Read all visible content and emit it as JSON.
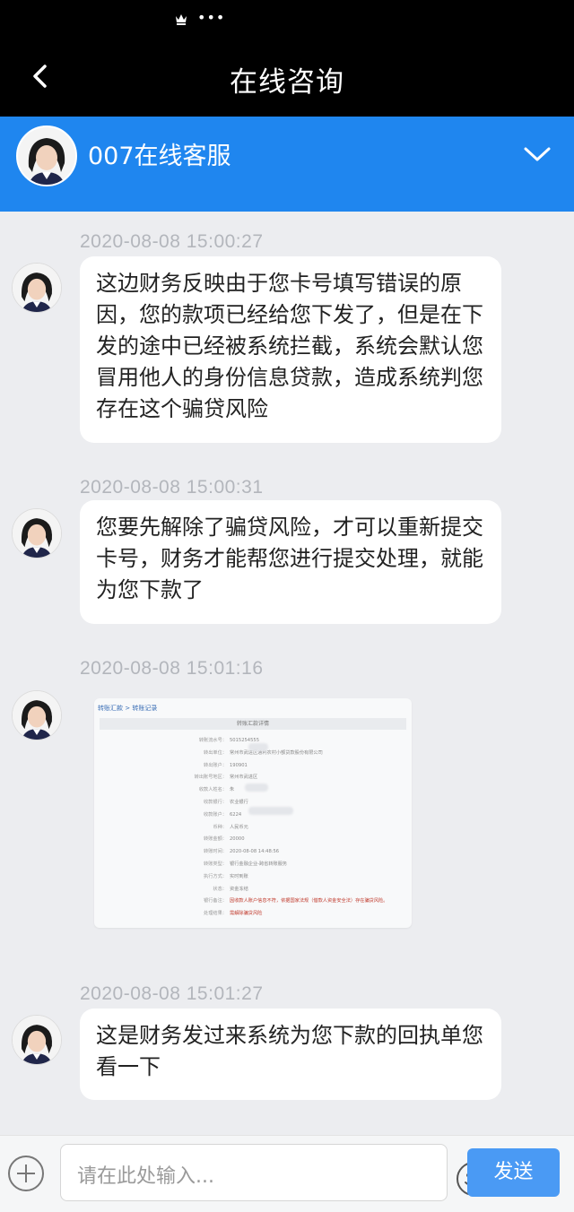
{
  "status_bar": {
    "dots": "•••"
  },
  "nav": {
    "title": "在线咨询"
  },
  "agent": {
    "name": "007在线客服"
  },
  "messages": [
    {
      "time": "2020-08-08 15:00:27",
      "text": "这边财务反映由于您卡号填写错误的原因，您的款项已经给您下发了，但是在下发的途中已经被系统拦截，系统会默认您冒用他人的身份信息贷款，造成系统判您存在这个骗贷风险"
    },
    {
      "time": "2020-08-08 15:00:31",
      "text": "您要先解除了骗贷风险，才可以重新提交卡号，财务才能帮您进行提交处理，就能为您下款了"
    },
    {
      "time": "2020-08-08 15:01:16",
      "image": {
        "breadcrumb": "转账汇款 > 转账记录",
        "header": "转账汇款详情",
        "rows": [
          {
            "k": "转账流水号：",
            "v": "5015254555"
          },
          {
            "k": "转出单位：",
            "v": "常州市武进区通利农村小额贷款股份有限公司"
          },
          {
            "k": "转出账户：",
            "v": "190901"
          },
          {
            "k": "转出账号地区：",
            "v": "常州市武进区"
          },
          {
            "k": "收款人姓名：",
            "v": "朱"
          },
          {
            "k": "收款银行：",
            "v": "农业银行"
          },
          {
            "k": "收款账户：",
            "v": "6224"
          },
          {
            "k": "币种：",
            "v": "人民币元"
          },
          {
            "k": "转账金额：",
            "v": "20000"
          },
          {
            "k": "转账时间：",
            "v": "2020-08-08 14:48:56"
          },
          {
            "k": "转账类型：",
            "v": "银行金融企业-跨省转账服务"
          },
          {
            "k": "执行方式：",
            "v": "实时到账"
          },
          {
            "k": "状态：",
            "v": "资金冻结"
          },
          {
            "k": "银行备注：",
            "v": "因收款人账户信息不符，依据国家法规（借款人资金安全法）存在骗贷风险。"
          },
          {
            "k": "处理结果：",
            "v": "需解除骗贷风险"
          }
        ]
      }
    },
    {
      "time": "2020-08-08 15:01:27",
      "text": "这是财务发过来系统为您下款的回执单您看一下"
    }
  ],
  "input": {
    "placeholder": "请在此处输入...",
    "send_label": "发送"
  },
  "colors": {
    "nav_bg": "#000000",
    "agent_bar": "#1f86ef",
    "send_button": "#4a9af4",
    "chat_bg": "#ecedf0"
  }
}
